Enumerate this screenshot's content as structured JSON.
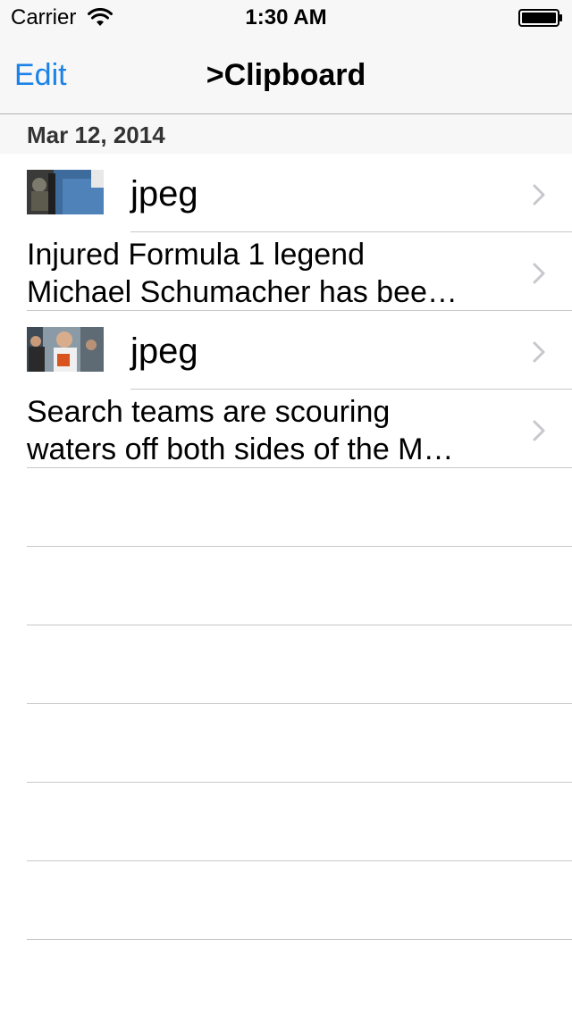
{
  "status_bar": {
    "carrier": "Carrier",
    "time": "1:30 AM",
    "wifi_icon": "wifi-icon",
    "battery_icon": "battery-icon"
  },
  "nav_bar": {
    "edit_label": "Edit",
    "title": ">Clipboard"
  },
  "colors": {
    "accent": "#1a82e8",
    "separator": "#c8c7cc",
    "chevron": "#c7c7cc",
    "bar_background": "#f7f7f7"
  },
  "section": {
    "date": "Mar 12, 2014"
  },
  "items": [
    {
      "kind": "image",
      "title": "jpeg",
      "thumbnail": "photo-thumbnail-aircraft-crew"
    },
    {
      "kind": "text",
      "line1": "Injured Formula 1 legend",
      "line2": "Michael Schumacher has bee…"
    },
    {
      "kind": "image",
      "title": "jpeg",
      "thumbnail": "photo-thumbnail-racing-driver"
    },
    {
      "kind": "text",
      "line1": "Search teams are scouring",
      "line2": "waters off both sides of the M…"
    }
  ]
}
